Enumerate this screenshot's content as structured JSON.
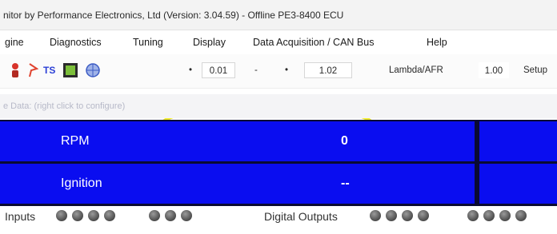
{
  "window": {
    "title": "nitor by Performance Electronics, Ltd  (Version: 3.04.59)  - Offline  PE3-8400 ECU"
  },
  "menu": {
    "items": [
      "gine",
      "Diagnostics",
      "Tuning",
      "Display",
      "Data Acquisition / CAN Bus",
      "Help"
    ]
  },
  "toolbar": {
    "icons": [
      "user-icon",
      "flag-icon",
      "ts-icon",
      "chip-icon",
      "globe-icon"
    ],
    "ts_label": "TS",
    "first_dot": "•",
    "value_a": "0.01",
    "dash": "-",
    "second_dot": "•",
    "value_b": "1.02",
    "lambda_label": "Lambda/AFR",
    "lambda_value": "1.00",
    "setup_label": "Setup"
  },
  "hint": {
    "text": "e Data: (right click to configure)"
  },
  "gauges": [
    {
      "label": "RPM",
      "value": "0"
    },
    {
      "label": "Ignition",
      "value": "--"
    }
  ],
  "status": {
    "inputs_label": "Inputs",
    "outputs_label": "Digital Outputs"
  },
  "colors": {
    "gauge_blue": "#0a0df0",
    "highlight_yellow": "#f1ec2a"
  }
}
